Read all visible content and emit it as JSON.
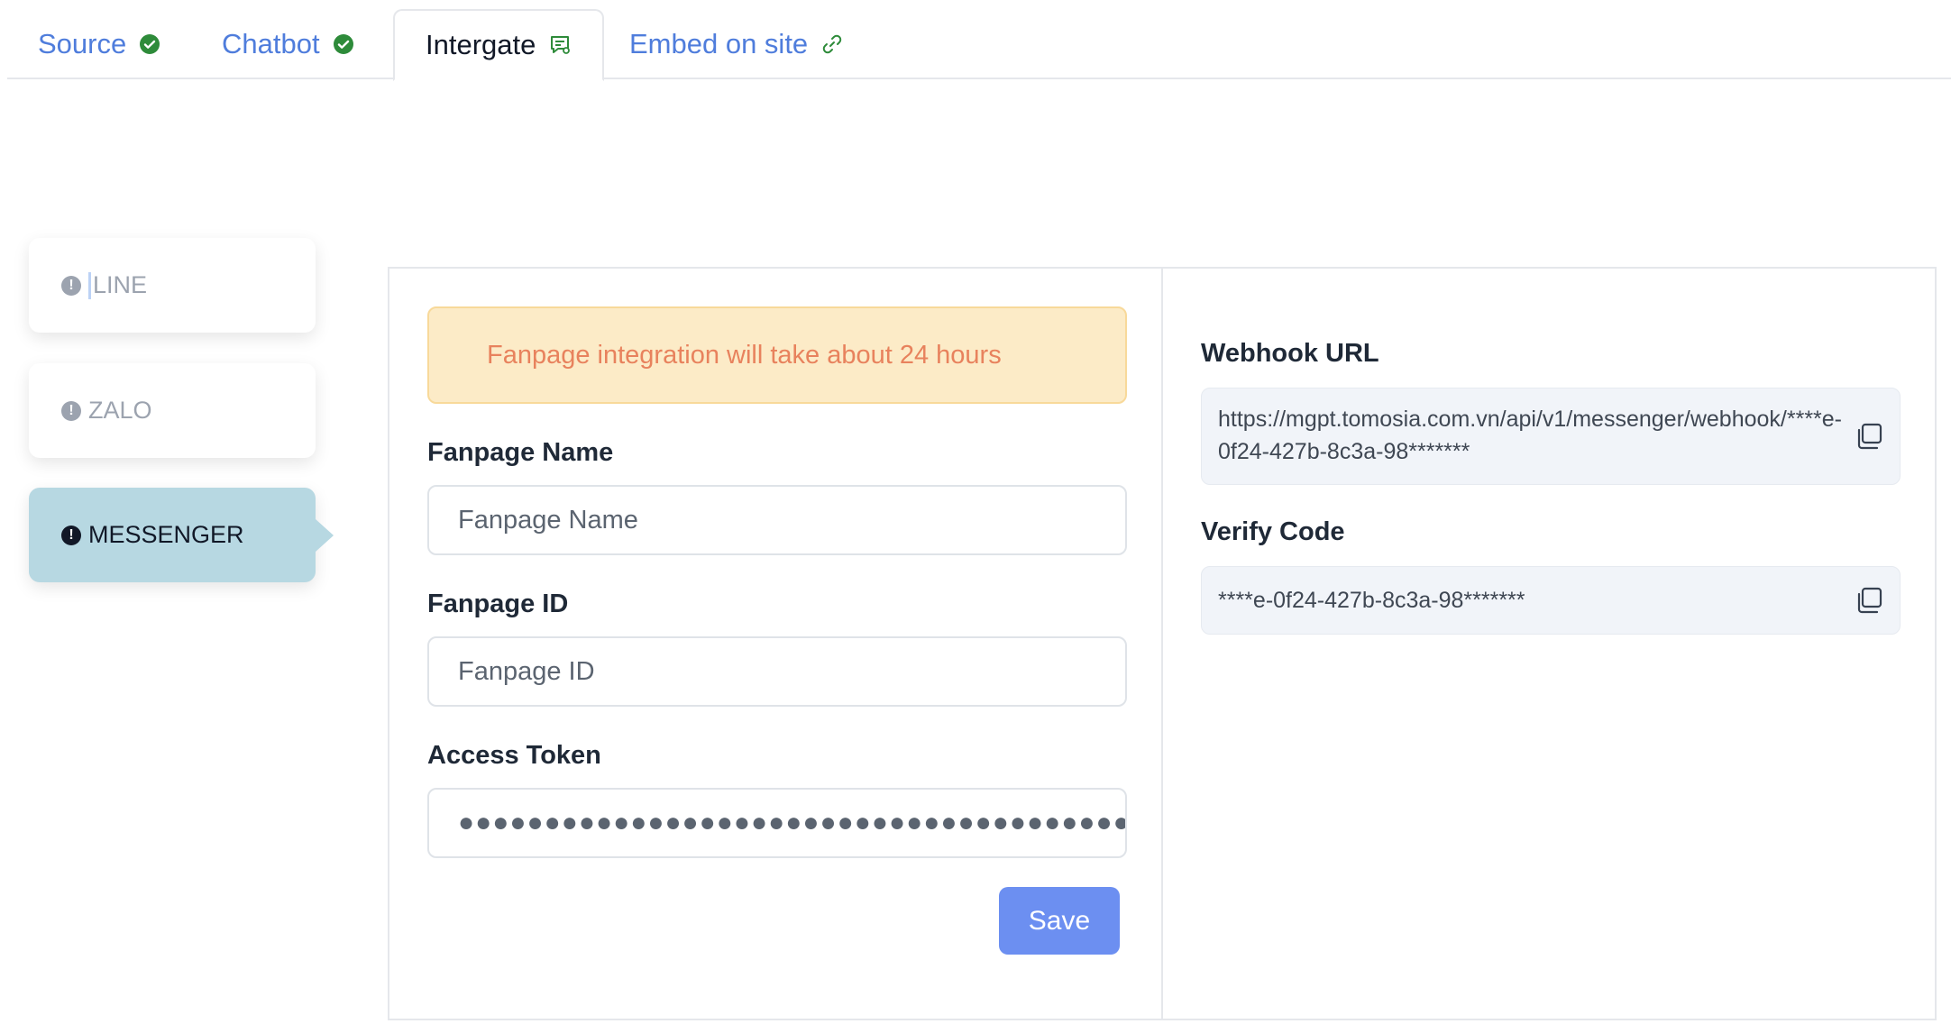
{
  "tabs": [
    {
      "label": "Source",
      "icon": "check-circle-icon",
      "state": "done"
    },
    {
      "label": "Chatbot",
      "icon": "check-circle-icon",
      "state": "done"
    },
    {
      "label": "Intergate",
      "icon": "chat-settings-icon",
      "state": "active"
    },
    {
      "label": "Embed on site",
      "icon": "link-icon",
      "state": "pending"
    }
  ],
  "channels": [
    {
      "label": "LINE",
      "icon": "warning-icon",
      "active": false
    },
    {
      "label": "ZALO",
      "icon": "warning-icon",
      "active": false
    },
    {
      "label": "MESSENGER",
      "icon": "warning-icon",
      "active": true
    }
  ],
  "form": {
    "alert": "Fanpage integration will take about 24 hours",
    "fanpage_name_label": "Fanpage Name",
    "fanpage_name_placeholder": "Fanpage Name",
    "fanpage_id_label": "Fanpage ID",
    "fanpage_id_placeholder": "Fanpage ID",
    "access_token_label": "Access Token",
    "access_token_value": "●●●●●●●●●●●●●●●●●●●●●●●●●●●●●●●●●●●●●●●●●●●●●●●●●●●●",
    "save_label": "Save"
  },
  "info": {
    "webhook_label": "Webhook URL",
    "webhook_value": "https://mgpt.tomosia.com.vn/api/v1/messenger/webhook/****e-0f24-427b-8c3a-98*******",
    "verify_label": "Verify Code",
    "verify_value": "****e-0f24-427b-8c3a-98*******"
  },
  "colors": {
    "accent": "#4f7ddc",
    "success": "#2e8b3a",
    "active_channel_bg": "#b7d8e2",
    "alert_bg": "#fcebc7",
    "alert_text": "#e8825d",
    "save_button": "#6c8ff1"
  }
}
